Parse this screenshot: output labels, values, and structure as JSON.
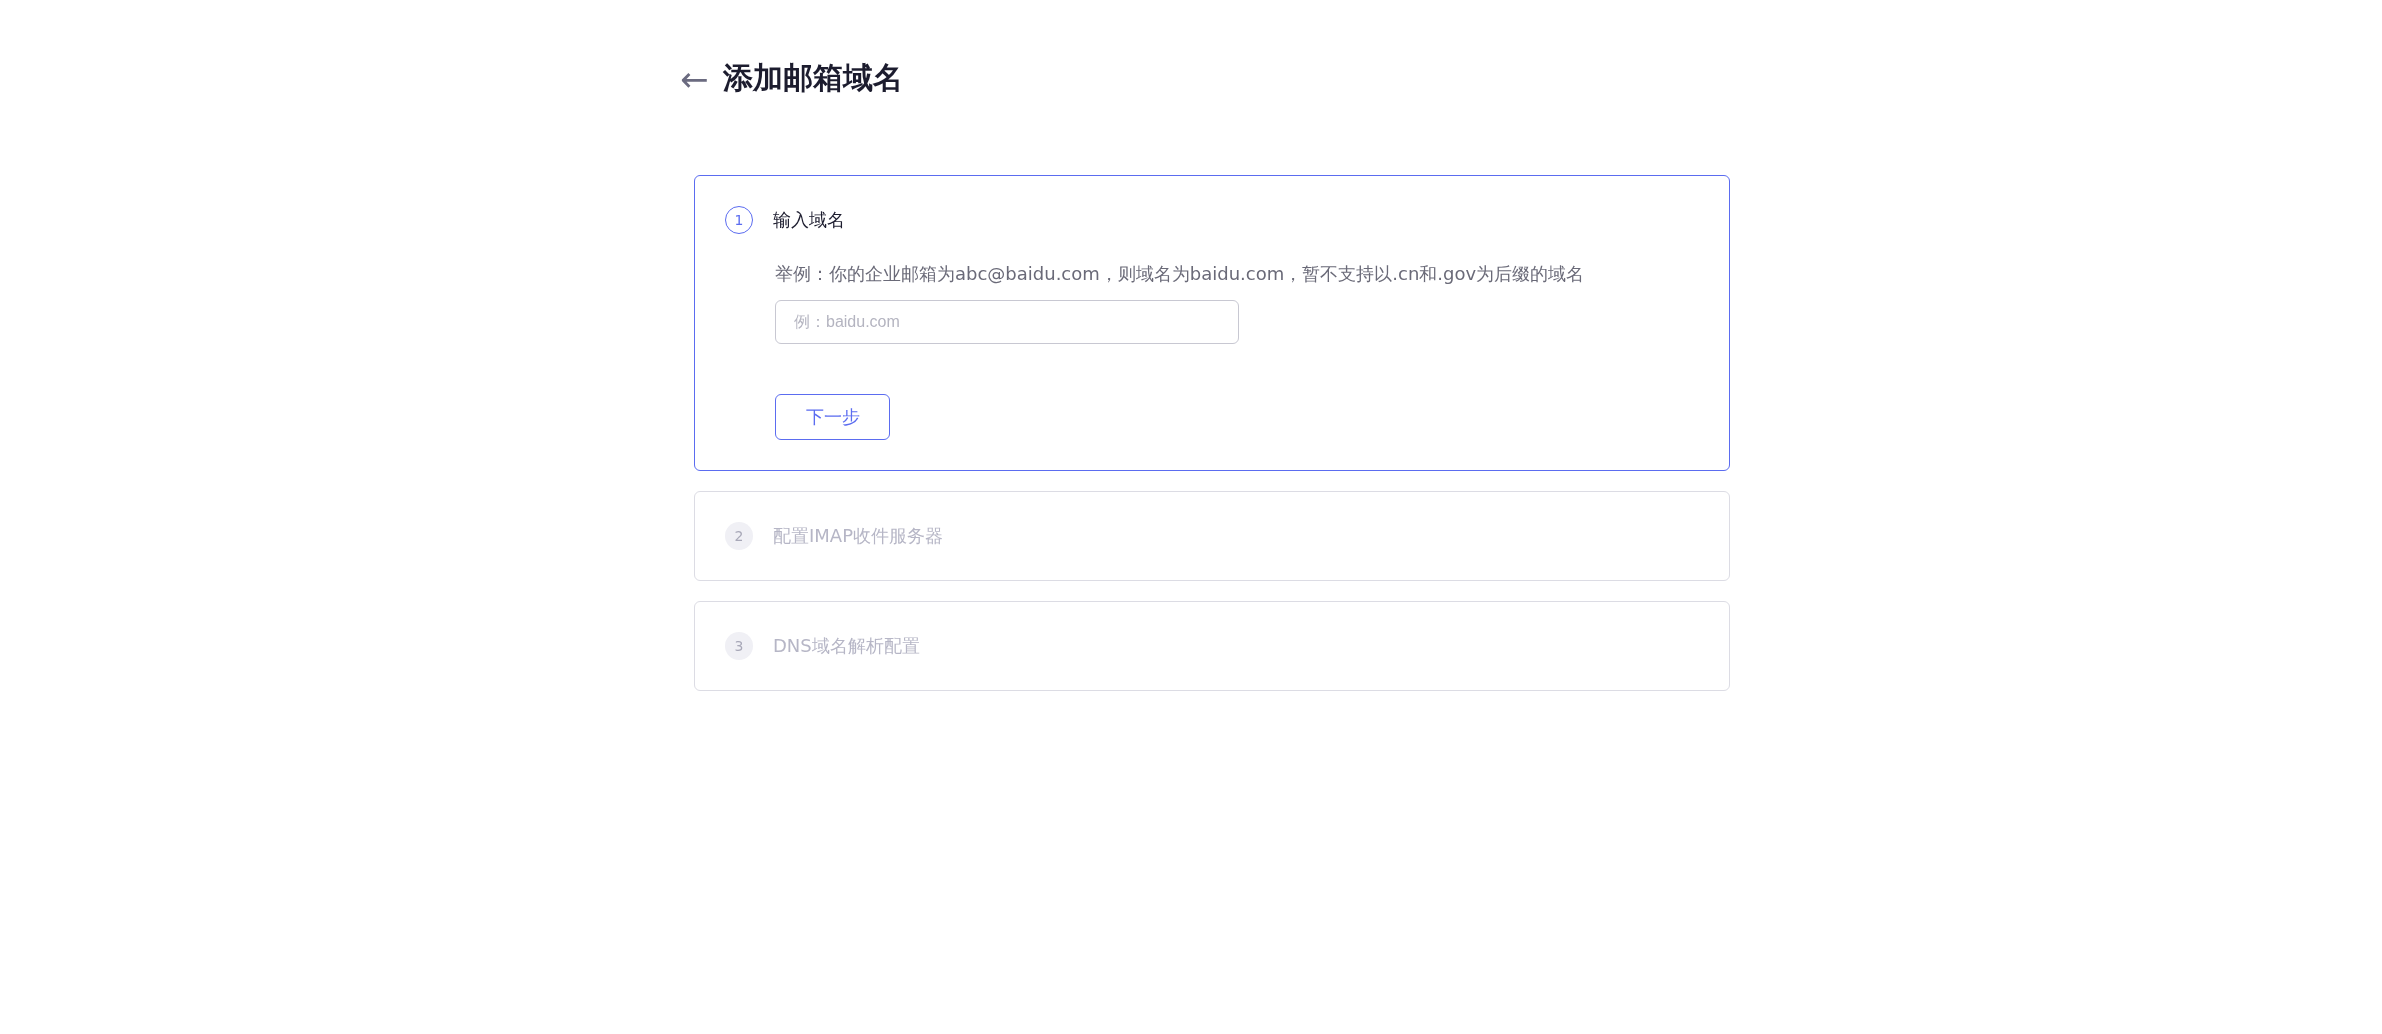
{
  "header": {
    "back": "←",
    "title": "添加邮箱域名"
  },
  "steps": [
    {
      "number": "1",
      "title": "输入域名",
      "active": true,
      "hint": "举例：你的企业邮箱为abc@baidu.com，则域名为baidu.com，暂不支持以.cn和.gov为后缀的域名",
      "input": {
        "placeholder": "例：baidu.com"
      },
      "button": "下一步"
    },
    {
      "number": "2",
      "title": "配置IMAP收件服务器",
      "active": false
    },
    {
      "number": "3",
      "title": "DNS域名解析配置",
      "active": false
    }
  ]
}
